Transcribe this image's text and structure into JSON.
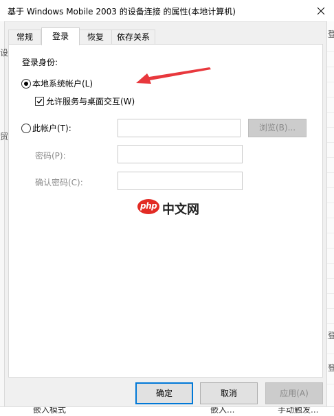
{
  "window": {
    "title": "基于 Windows Mobile 2003 的设备连接 的属性(本地计算机)"
  },
  "tabs": [
    {
      "label": "常规"
    },
    {
      "label": "登录"
    },
    {
      "label": "恢复"
    },
    {
      "label": "依存关系"
    }
  ],
  "logon": {
    "section_label": "登录身份:",
    "local_system_label": "本地系统帐户(L)",
    "allow_desktop_label": "允许服务与桌面交互(W)",
    "this_account_label": "此帐户(T):",
    "browse_label": "浏览(B)...",
    "password_label": "密码(P):",
    "confirm_label": "确认密码(C):",
    "account_value": "",
    "password_value": "",
    "confirm_value": ""
  },
  "buttons": {
    "ok": "确定",
    "cancel": "取消",
    "apply": "应用(A)"
  },
  "watermark": {
    "php": "php",
    "text": "中文网"
  },
  "background": {
    "bottom_text_1": "嵌入模式",
    "bottom_text_2": "嵌入...",
    "bottom_text_3": "手动触发...",
    "left_edge_1": "设",
    "left_edge_2": "贸",
    "right_edge_1": "登",
    "right_edge_2": "登",
    "right_edge_3": "登"
  },
  "colors": {
    "accent": "#0078d7",
    "arrow": "#e8383d",
    "watermark_red": "#e22b24"
  }
}
